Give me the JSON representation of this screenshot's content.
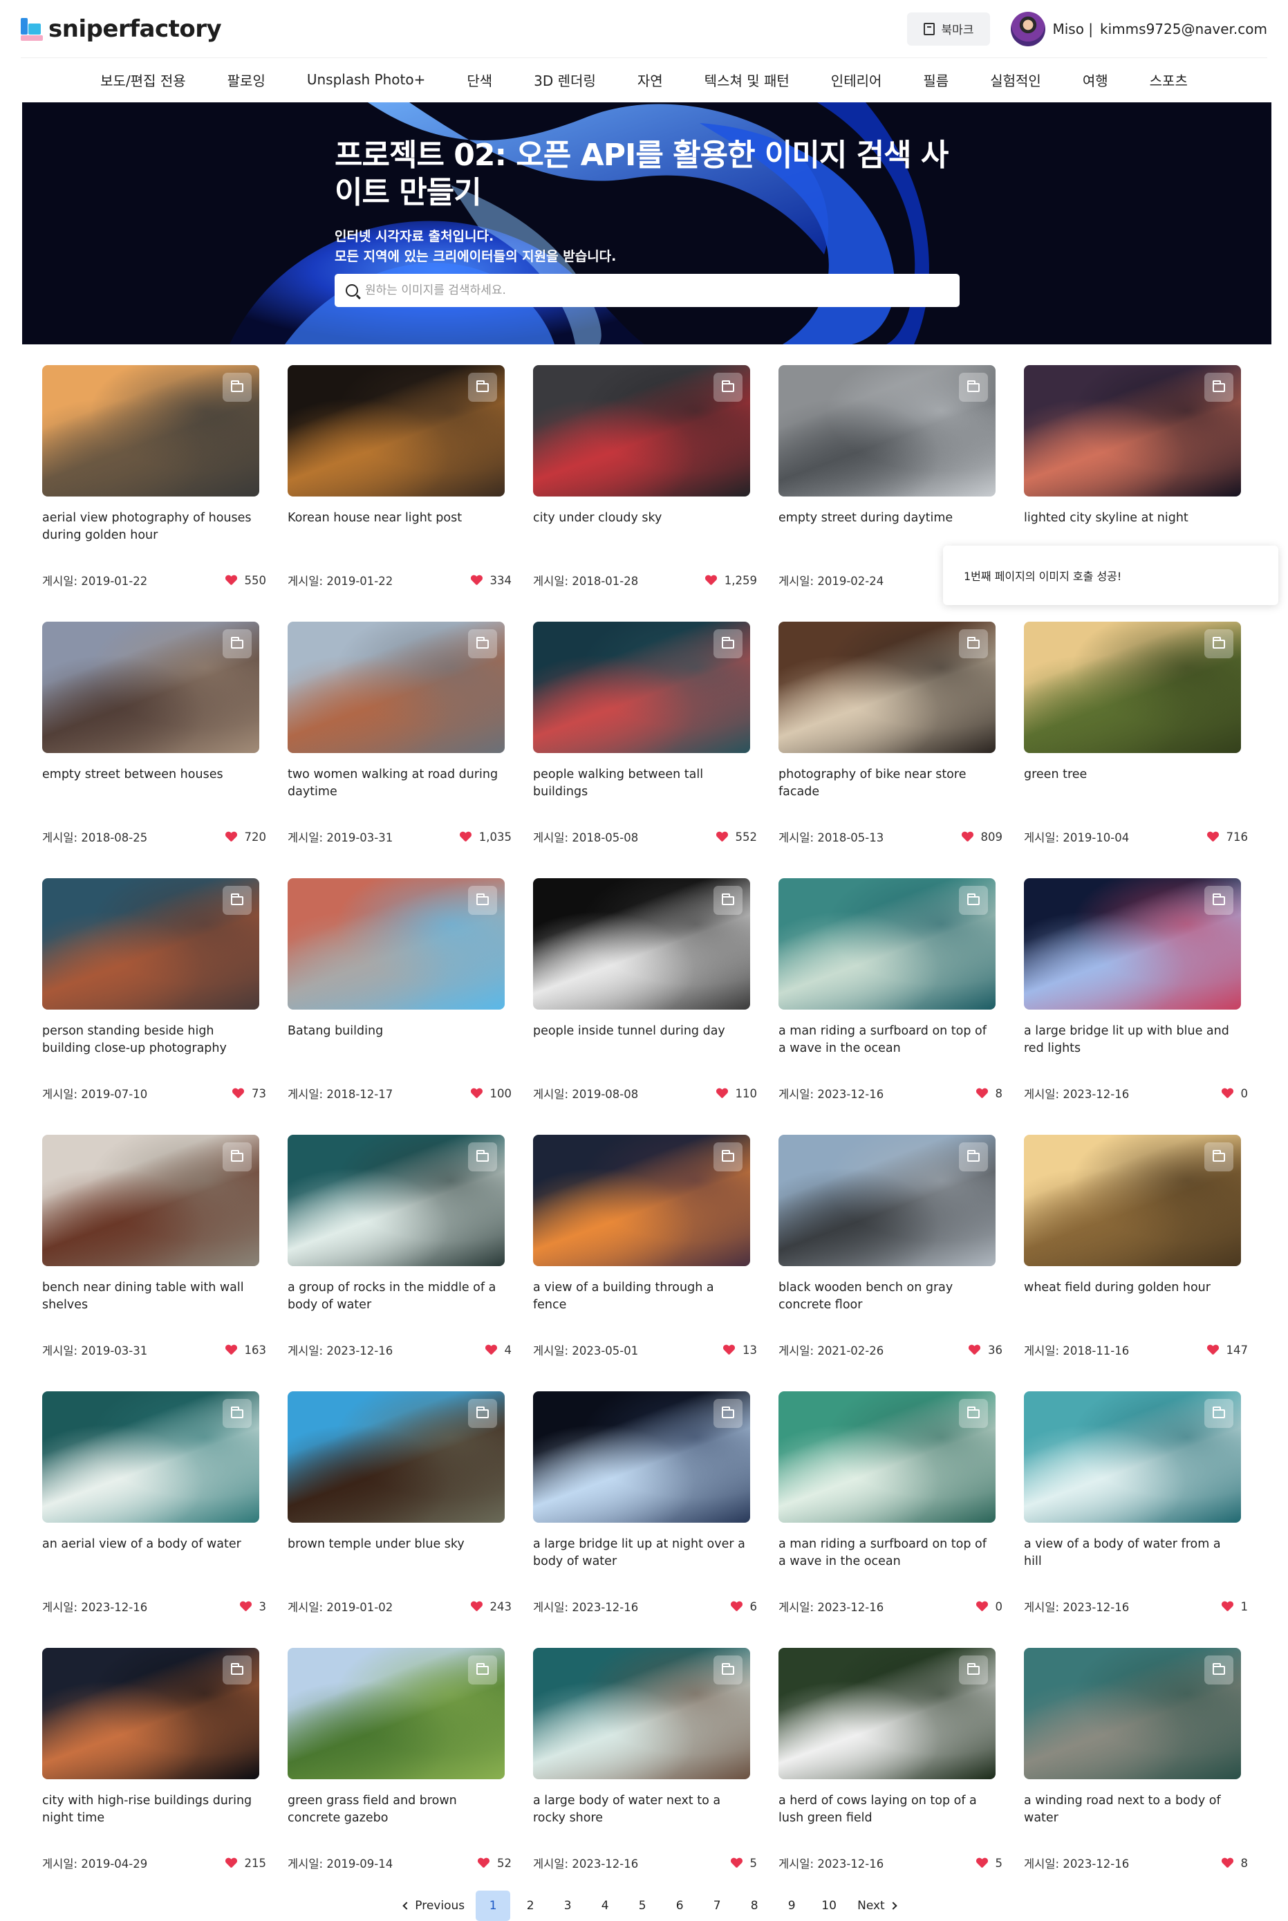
{
  "header": {
    "logo_text": "sniperfactory",
    "bookmark_label": "북마크",
    "user_name": "Miso |",
    "user_email": "kimms9725@naver.com"
  },
  "nav": [
    "보도/편집 전용",
    "팔로잉",
    "Unsplash Photo+",
    "단색",
    "3D 렌더링",
    "자연",
    "텍스쳐 및 패턴",
    "인테리어",
    "필름",
    "실험적인",
    "여행",
    "스포츠"
  ],
  "hero": {
    "title": "프로젝트 02: 오픈 API를 활용한 이미지 검색 사이트 만들기",
    "sub1": "인터넷 시각자료 출처입니다.",
    "sub2": "모든 지역에 있는 크리에이터들의 지원을 받습니다.",
    "search_placeholder": "원하는 이미지를 검색하세요."
  },
  "toast": "1번째 페이지의 이미지 호출 성공!",
  "date_prefix": "게시일: ",
  "cards": [
    {
      "desc": "aerial view photography of houses during golden hour",
      "date": "2019-01-22",
      "likes": "550",
      "colors": [
        "#e8a45c",
        "#6b5842",
        "#3a3a38"
      ]
    },
    {
      "desc": "Korean house near light post",
      "date": "2019-01-22",
      "likes": "334",
      "colors": [
        "#1a1410",
        "#b7752f",
        "#3b2c20"
      ]
    },
    {
      "desc": "city under cloudy sky",
      "date": "2018-01-28",
      "likes": "1,259",
      "colors": [
        "#3a3a3e",
        "#c4363c",
        "#222226"
      ]
    },
    {
      "desc": "empty street during daytime",
      "date": "2019-02-24",
      "likes": "",
      "colors": [
        "#8c8f92",
        "#505458",
        "#c8ccd0"
      ]
    },
    {
      "desc": "lighted city skyline at night",
      "date": "",
      "likes": "",
      "colors": [
        "#3a2a40",
        "#d0705a",
        "#151220"
      ]
    },
    {
      "desc": "empty street between houses",
      "date": "2018-08-25",
      "likes": "720",
      "colors": [
        "#8a93a8",
        "#523f38",
        "#a28c78"
      ]
    },
    {
      "desc": "two women walking at road during daytime",
      "date": "2019-03-31",
      "likes": "1,035",
      "colors": [
        "#a8b8c8",
        "#b06848",
        "#6a7078"
      ]
    },
    {
      "desc": "people walking between tall buildings",
      "date": "2018-05-08",
      "likes": "552",
      "colors": [
        "#163845",
        "#c84a4a",
        "#28535c"
      ]
    },
    {
      "desc": "photography of bike near store facade",
      "date": "2018-05-13",
      "likes": "809",
      "colors": [
        "#5a3a28",
        "#d8c8b0",
        "#2a2420"
      ]
    },
    {
      "desc": "green tree",
      "date": "2019-10-04",
      "likes": "716",
      "colors": [
        "#e8c888",
        "#5c7030",
        "#34401c"
      ]
    },
    {
      "desc": "person standing beside high building close-up photography",
      "date": "2019-07-10",
      "likes": "73",
      "colors": [
        "#2c5468",
        "#a85838",
        "#4a3a38"
      ]
    },
    {
      "desc": "Batang building",
      "date": "2018-12-17",
      "likes": "100",
      "colors": [
        "#c86a58",
        "#a8a8a8",
        "#5ab8e8"
      ]
    },
    {
      "desc": "people inside tunnel during day",
      "date": "2019-08-08",
      "likes": "110",
      "colors": [
        "#0e0e0e",
        "#e8e8e8",
        "#3a3a3a"
      ]
    },
    {
      "desc": "a man riding a surfboard on top of a wave in the ocean",
      "date": "2023-12-16",
      "likes": "8",
      "colors": [
        "#3a8884",
        "#c8dcd0",
        "#1c5c64"
      ]
    },
    {
      "desc": "a large bridge lit up with blue and red lights",
      "date": "2023-12-16",
      "likes": "0",
      "colors": [
        "#101a38",
        "#a0b8e8",
        "#c84060"
      ]
    },
    {
      "desc": "bench near dining table with wall shelves",
      "date": "2019-03-31",
      "likes": "163",
      "colors": [
        "#d8d0c8",
        "#6a3828",
        "#8a8478"
      ]
    },
    {
      "desc": "a group of rocks in the middle of a body of water",
      "date": "2023-12-16",
      "likes": "4",
      "colors": [
        "#1e5a5e",
        "#e0ece8",
        "#2a3a38"
      ]
    },
    {
      "desc": "a view of a building through a fence",
      "date": "2023-05-01",
      "likes": "13",
      "colors": [
        "#1c2438",
        "#e88838",
        "#4a3040"
      ]
    },
    {
      "desc": "black wooden bench on gray concrete floor",
      "date": "2021-02-26",
      "likes": "36",
      "colors": [
        "#8fa8c0",
        "#3a3e42",
        "#b0b8c0"
      ]
    },
    {
      "desc": "wheat field during golden hour",
      "date": "2018-11-16",
      "likes": "147",
      "colors": [
        "#f0d090",
        "#8a6838",
        "#4a3820"
      ]
    },
    {
      "desc": "an aerial view of a body of water",
      "date": "2023-12-16",
      "likes": "3",
      "colors": [
        "#1c5a5a",
        "#e8f0ec",
        "#2e7878"
      ]
    },
    {
      "desc": "brown temple under blue sky",
      "date": "2019-01-02",
      "likes": "243",
      "colors": [
        "#38a0d8",
        "#3a2418",
        "#6a6a58"
      ]
    },
    {
      "desc": "a large bridge lit up at night over a body of water",
      "date": "2023-12-16",
      "likes": "6",
      "colors": [
        "#0a0e1a",
        "#c0d8f0",
        "#283858"
      ]
    },
    {
      "desc": "a man riding a surfboard on top of a wave in the ocean",
      "date": "2023-12-16",
      "likes": "0",
      "colors": [
        "#3a9880",
        "#e0eee4",
        "#2a6458"
      ]
    },
    {
      "desc": "a view of a body of water from a hill",
      "date": "2023-12-16",
      "likes": "1",
      "colors": [
        "#4aa8b0",
        "#e0f0f0",
        "#206870"
      ]
    },
    {
      "desc": "city with high-rise buildings during night time",
      "date": "2019-04-29",
      "likes": "215",
      "colors": [
        "#1a2030",
        "#c87040",
        "#0a0c12"
      ]
    },
    {
      "desc": "green grass field and brown concrete gazebo",
      "date": "2019-09-14",
      "likes": "52",
      "colors": [
        "#b8d0e8",
        "#4a7830",
        "#8ab050"
      ]
    },
    {
      "desc": "a large body of water next to a rocky shore",
      "date": "2023-12-16",
      "likes": "5",
      "colors": [
        "#1e6468",
        "#d8e8e4",
        "#6a5040"
      ]
    },
    {
      "desc": "a herd of cows laying on top of a lush green field",
      "date": "2023-12-16",
      "likes": "5",
      "colors": [
        "#2a4028",
        "#f0f0f0",
        "#1a2a18"
      ]
    },
    {
      "desc": "a winding road next to a body of water",
      "date": "2023-12-16",
      "likes": "8",
      "colors": [
        "#3a7878",
        "#8a8a80",
        "#2a5048"
      ]
    }
  ],
  "pagination": {
    "previous": "Previous",
    "next": "Next",
    "pages": [
      "1",
      "2",
      "3",
      "4",
      "5",
      "6",
      "7",
      "8",
      "9",
      "10"
    ],
    "active": "1"
  }
}
